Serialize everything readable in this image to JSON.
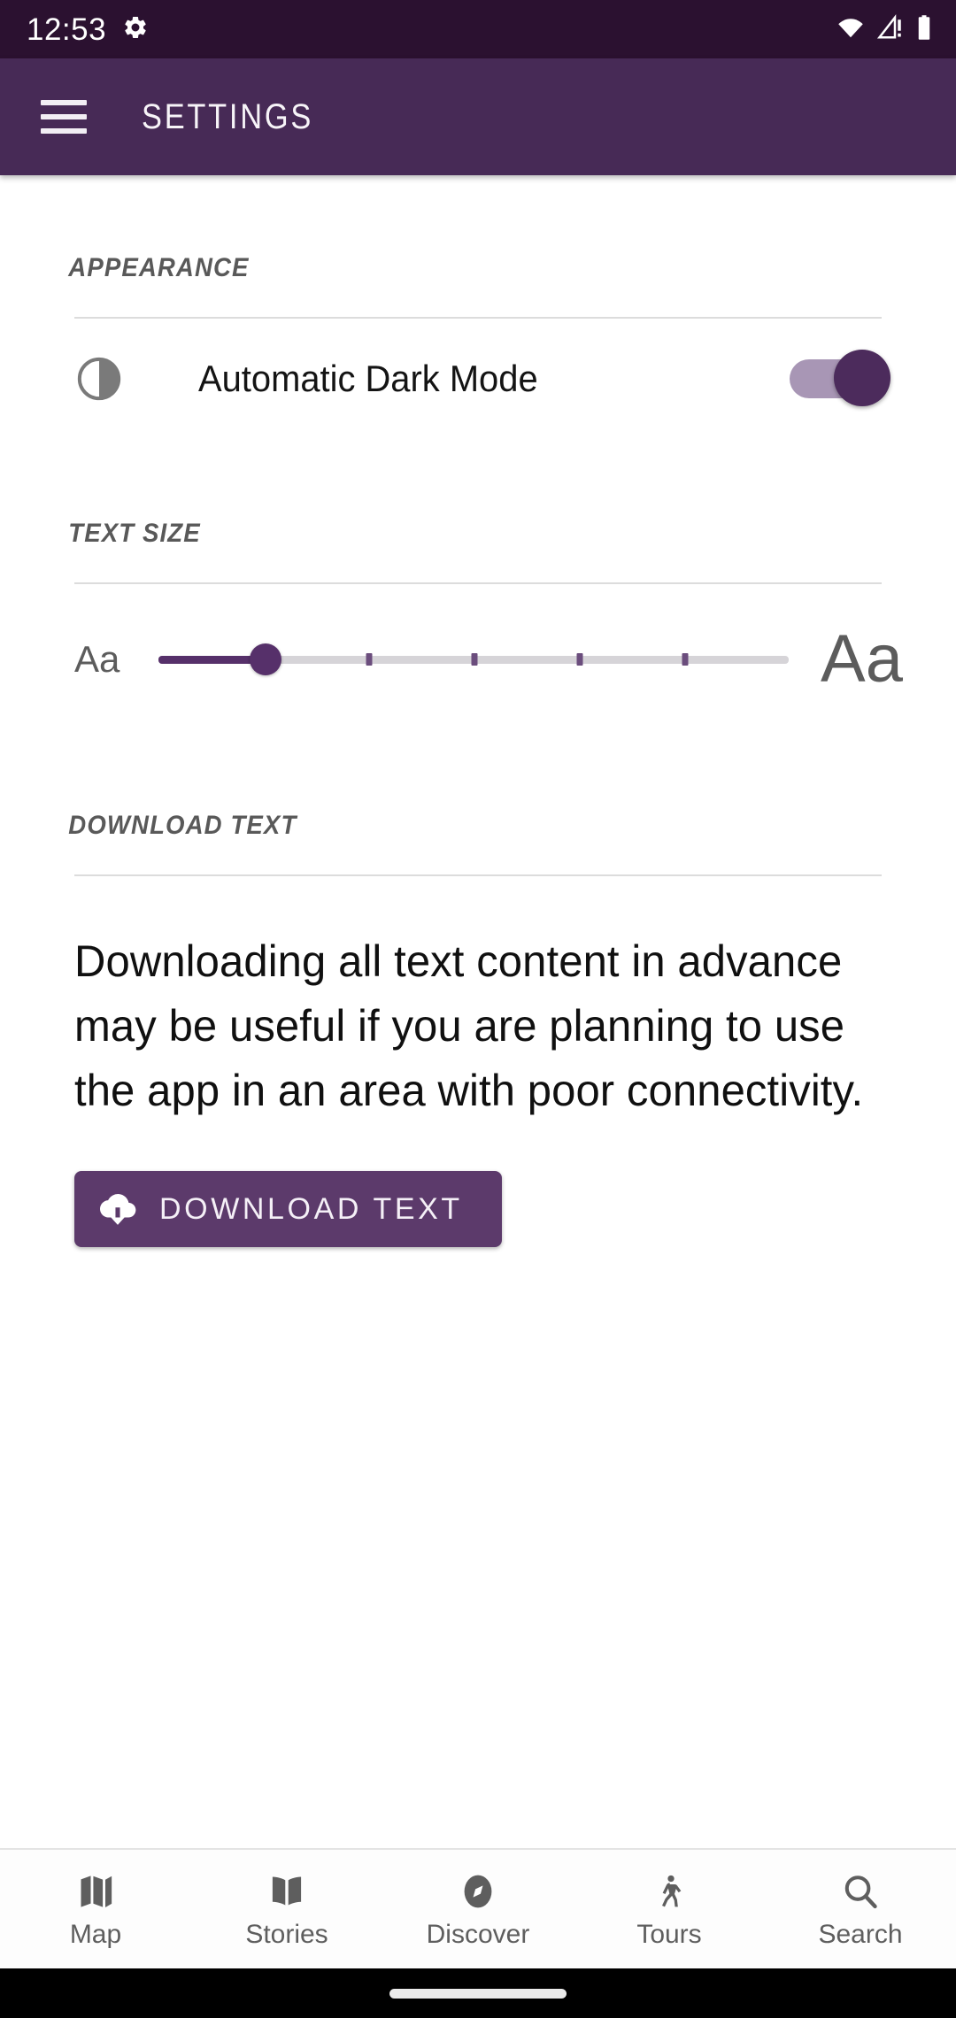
{
  "status_bar": {
    "time": "12:53",
    "icons": [
      "gear-icon",
      "wifi-icon",
      "cellular-no-sim-icon",
      "battery-full-icon"
    ],
    "background": "#2b1130"
  },
  "app_bar": {
    "title": "SETTINGS",
    "menu_icon": "hamburger-menu-icon",
    "background": "#472a56"
  },
  "sections": {
    "appearance": {
      "header": "APPEARANCE",
      "dark_mode": {
        "label": "Automatic Dark Mode",
        "icon": "brightness-contrast-icon",
        "toggle_on": true,
        "toggle_track_color": "#a896b5",
        "toggle_thumb_color": "#4c2b5c"
      }
    },
    "text_size": {
      "header": "TEXT SIZE",
      "small_label": "Aa",
      "large_label": "Aa",
      "value": 1,
      "min": 0,
      "max": 5,
      "steps": 6,
      "active_color": "#56306a",
      "inactive_color": "#d6d4d8"
    },
    "download_text": {
      "header": "DOWNLOAD TEXT",
      "description": "Downloading all text content in advance may be useful if you are planning to use the app in an area with poor connectivity.",
      "button_label": "DOWNLOAD TEXT",
      "button_icon": "cloud-download-icon",
      "button_color": "#5c3a6b"
    }
  },
  "bottom_nav": {
    "items": [
      {
        "label": "Map",
        "icon": "map-icon"
      },
      {
        "label": "Stories",
        "icon": "book-icon"
      },
      {
        "label": "Discover",
        "icon": "compass-icon"
      },
      {
        "label": "Tours",
        "icon": "walking-person-icon"
      },
      {
        "label": "Search",
        "icon": "search-icon"
      }
    ],
    "icon_color": "#5e5e5e"
  },
  "gesture_bar": {
    "handle": "home-gesture-pill"
  }
}
